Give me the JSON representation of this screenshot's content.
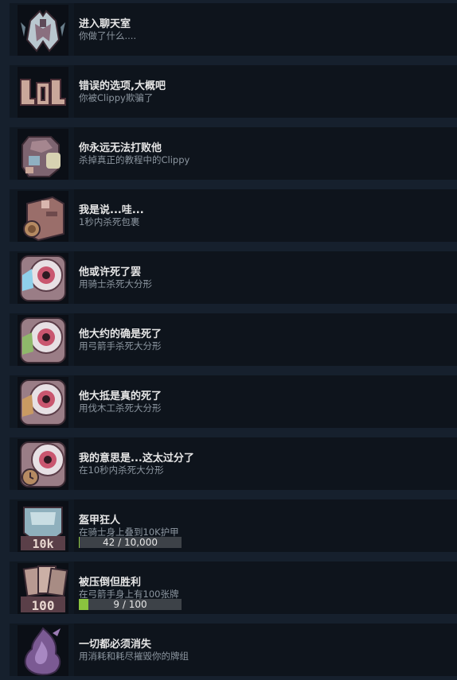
{
  "achievements": [
    {
      "title": "进入聊天室",
      "desc": "你做了什么....",
      "icon": "heart-wings-icon"
    },
    {
      "title": "错误的选项,大概吧",
      "desc": "你被Clippy欺骗了",
      "icon": "lol-text-icon"
    },
    {
      "title": "你永远无法打败他",
      "desc": "杀掉真正的教程中的Clippy",
      "icon": "clippy-icon"
    },
    {
      "title": "我是说...哇...",
      "desc": "1秒内杀死包裹",
      "icon": "package-icon"
    },
    {
      "title": "他或许死了罢",
      "desc": "用骑士杀死大分形",
      "icon": "eye-boss-knight-icon"
    },
    {
      "title": "他大约的确是死了",
      "desc": "用弓箭手杀死大分形",
      "icon": "eye-boss-archer-icon"
    },
    {
      "title": "他大抵是真的死了",
      "desc": "用伐木工杀死大分形",
      "icon": "eye-boss-lumberjack-icon"
    },
    {
      "title": "我的意思是...这太过分了",
      "desc": "在10秒内杀死大分形",
      "icon": "eye-boss-timer-icon"
    },
    {
      "title": "盔甲狂人",
      "desc": "在骑士身上叠到10K护甲",
      "icon": "armor-10k-icon",
      "progress": {
        "text": "42 / 10,000",
        "fraction": 0.0042
      }
    },
    {
      "title": "被压倒但胜利",
      "desc": "在弓箭手身上有100张牌",
      "icon": "cards-100-icon",
      "progress": {
        "text": "9 / 100",
        "fraction": 0.09
      }
    },
    {
      "title": "一切都必须消失",
      "desc": "用消耗和耗尽摧毁你的牌组",
      "icon": "purple-flame-icon"
    }
  ],
  "colors": {
    "page_bg": "#16202d",
    "row_bg": "#0e141c",
    "title": "#e6e6e6",
    "desc": "#8c96a0",
    "progress_track": "#3d4248",
    "progress_fill": "#8bc43f"
  }
}
